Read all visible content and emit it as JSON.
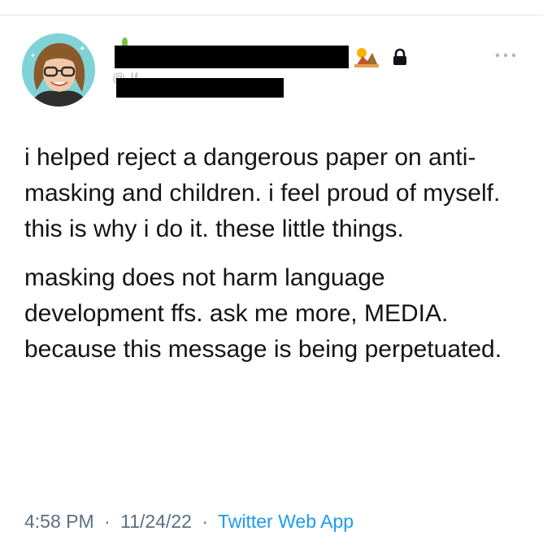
{
  "header": {
    "handle_fragment": "@ lf",
    "icons": {
      "avatar": "avatar-illustration",
      "name_emoji": "desert-landscape-emoji",
      "protected": "lock-icon",
      "more": "more-options-icon"
    }
  },
  "tweet": {
    "paragraphs": [
      "i helped reject a dangerous paper on anti-masking and children. i feel proud of myself. this is why i do it. these little things.",
      "masking does not harm language development ffs. ask me more, MEDIA. because this message is being perpetuated."
    ]
  },
  "meta": {
    "time": "4:58 PM",
    "separator": "·",
    "date": "11/24/22",
    "source": "Twitter Web App"
  },
  "colors": {
    "text": "#141414",
    "meta": "#5b7083",
    "link": "#1d9bf0",
    "avatar_bg": "#7fd3d6"
  }
}
